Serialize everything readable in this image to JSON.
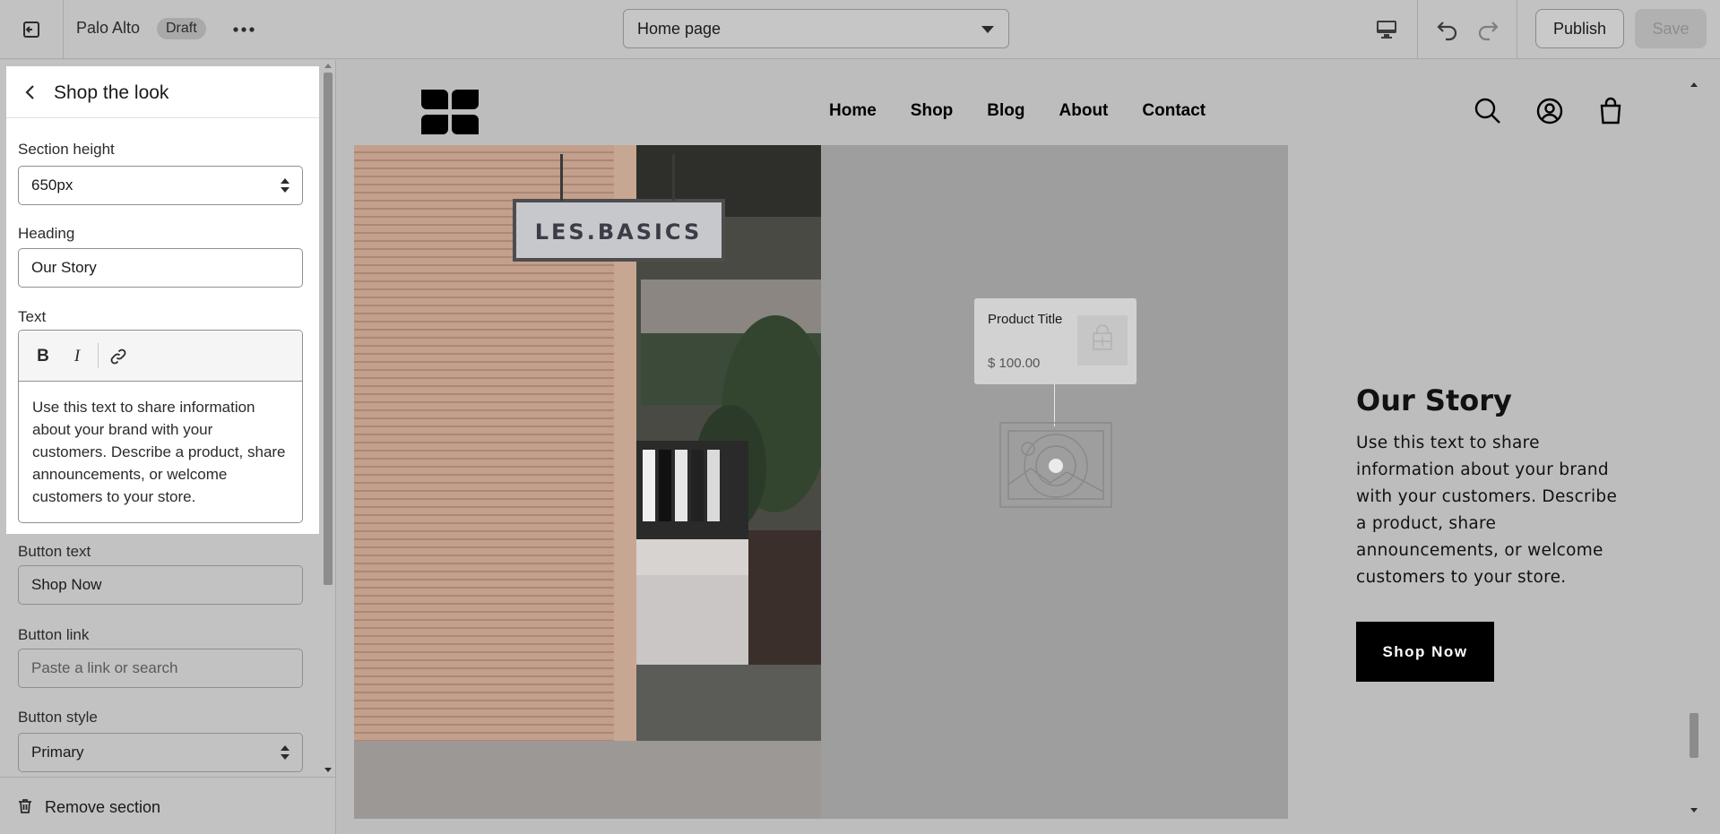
{
  "topbar": {
    "store_name": "Palo Alto",
    "status_badge": "Draft",
    "page_select": "Home page",
    "publish_label": "Publish",
    "save_label": "Save"
  },
  "panel": {
    "title": "Shop the look",
    "fields": {
      "section_height_label": "Section height",
      "section_height_value": "650px",
      "heading_label": "Heading",
      "heading_value": "Our Story",
      "text_label": "Text",
      "text_value": "Use this text to share information about your brand with your customers. Describe a product, share announcements, or welcome customers to your store.",
      "button_text_label": "Button text",
      "button_text_value": "Shop Now",
      "button_link_label": "Button link",
      "button_link_placeholder": "Paste a link or search",
      "button_style_label": "Button style",
      "button_style_value": "Primary"
    },
    "rte_toolbar": {
      "bold": "B",
      "italic": "I"
    },
    "remove_label": "Remove section"
  },
  "preview": {
    "nav": [
      "Home",
      "Shop",
      "Blog",
      "About",
      "Contact"
    ],
    "shop_sign": "LES.BASICS",
    "product_card": {
      "title": "Product Title",
      "price": "$ 100.00"
    },
    "story": {
      "heading": "Our Story",
      "text": "Use this text to share information about your brand with your customers. Describe a product, share announcements, or welcome customers to your store.",
      "button": "Shop Now"
    }
  },
  "icons": {
    "exit": "exit-icon",
    "more": "more-icon",
    "desktop": "desktop-icon",
    "undo": "undo-icon",
    "redo": "redo-icon",
    "back": "back-arrow-icon",
    "link": "link-icon",
    "trash": "trash-icon",
    "search": "search-icon",
    "account": "account-icon",
    "bag": "shopping-bag-icon"
  },
  "colors": {
    "overlay": "#bdbdbd",
    "button_dark": "#000000",
    "highlight": "#ffffff"
  }
}
